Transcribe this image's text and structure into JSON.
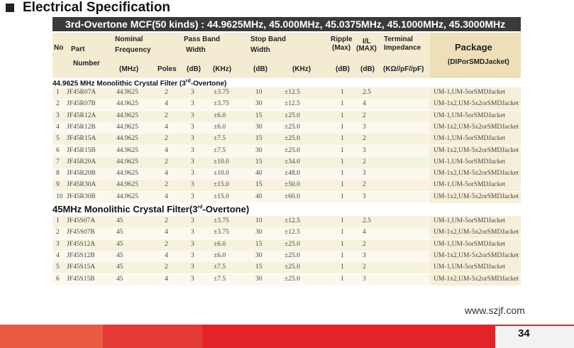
{
  "section_title": "Electrical Specification",
  "banner": "3rd-Overtone MCF(50 kinds) : 44.9625MHz, 45.000MHz, 45.0375MHz, 45.1000MHz, 45.3000MHz",
  "headers": {
    "no": "No",
    "part": "Part",
    "number": "Number",
    "nominal": "Nominal",
    "frequency": "Frequency",
    "mhz": "(MHz)",
    "poles": "Poles",
    "pass_band": "Pass  Band",
    "width1": "Width",
    "db1": "(dB)",
    "khz1": "(KHz)",
    "stop_band": "Stop    Band",
    "width2": "Width",
    "db2": "(dB)",
    "khz2": "(KHz)",
    "ripple": "Ripple",
    "max1": "(Max)",
    "db3": "(dB)",
    "il": "I/L",
    "max2": "(MAX)",
    "db4": "(dB)",
    "terminal": "Terminal",
    "impedance": "Impedance",
    "kohm_pf": "(KΩ//pF//pF)",
    "package": "Package",
    "package_sub": "(DIPorSMDJacket)"
  },
  "section1": {
    "title_pre": "44.9625 MHz Monolithic Crystal Filter (3",
    "title_sup": "rd",
    "title_post": "-Overtone)"
  },
  "rows1": [
    {
      "no": "1",
      "part": "JF45R07A",
      "freq": "44.9625",
      "poles": "2",
      "pdb": "3",
      "pkhz": "±3.75",
      "sdb": "10",
      "skhz": "±12.5",
      "ripple": "1",
      "il": "2.5",
      "pkg": "UM-1,UM-5orSMDJacket"
    },
    {
      "no": "2",
      "part": "JF45R07B",
      "freq": "44.9625",
      "poles": "4",
      "pdb": "3",
      "pkhz": "±3.75",
      "sdb": "30",
      "skhz": "±12.5",
      "ripple": "1",
      "il": "4",
      "pkg": "UM-1x2,UM-5x2orSMDJacket"
    },
    {
      "no": "3",
      "part": "JF45R12A",
      "freq": "44.9625",
      "poles": "2",
      "pdb": "3",
      "pkhz": "±6.0",
      "sdb": "15",
      "skhz": "±25.0",
      "ripple": "1",
      "il": "2",
      "pkg": "UM-1,UM-5orSMDJacket"
    },
    {
      "no": "4",
      "part": "JF45R12B",
      "freq": "44.9625",
      "poles": "4",
      "pdb": "3",
      "pkhz": "±6.0",
      "sdb": "30",
      "skhz": "±25.0",
      "ripple": "1",
      "il": "3",
      "pkg": "UM-1x2,UM-5x2orSMDJacket"
    },
    {
      "no": "5",
      "part": "JF45R15A",
      "freq": "44.9625",
      "poles": "2",
      "pdb": "3",
      "pkhz": "±7.5",
      "sdb": "15",
      "skhz": "±25.0",
      "ripple": "1",
      "il": "2",
      "pkg": "UM-1,UM-5orSMDJacket"
    },
    {
      "no": "6",
      "part": "JF45R15B",
      "freq": "44.9625",
      "poles": "4",
      "pdb": "3",
      "pkhz": "±7.5",
      "sdb": "30",
      "skhz": "±25.0",
      "ripple": "1",
      "il": "3",
      "pkg": "UM-1x2,UM-5x2orSMDJacket"
    },
    {
      "no": "7",
      "part": "JF45R20A",
      "freq": "44.9625",
      "poles": "2",
      "pdb": "3",
      "pkhz": "±10.0",
      "sdb": "15",
      "skhz": "±34.0",
      "ripple": "1",
      "il": "2",
      "pkg": "UM-1,UM-5orSMDJacket"
    },
    {
      "no": "8",
      "part": "JF45R20B",
      "freq": "44.9625",
      "poles": "4",
      "pdb": "3",
      "pkhz": "±10.0",
      "sdb": "40",
      "skhz": "±48.0",
      "ripple": "1",
      "il": "3",
      "pkg": "UM-1x2,UM-5x2orSMDJacket"
    },
    {
      "no": "9",
      "part": "JF45R30A",
      "freq": "44.9625",
      "poles": "2",
      "pdb": "3",
      "pkhz": "±15.0",
      "sdb": "15",
      "skhz": "±50.0",
      "ripple": "1",
      "il": "2",
      "pkg": "UM-1,UM-5orSMDJacket"
    },
    {
      "no": "10",
      "part": "JF45R30B",
      "freq": "44.9625",
      "poles": "4",
      "pdb": "3",
      "pkhz": "±15.0",
      "sdb": "40",
      "skhz": "±60.0",
      "ripple": "1",
      "il": "3",
      "pkg": "UM-1x2,UM-5x2orSMDJacket"
    }
  ],
  "section2": {
    "title_pre": "45MHz Monolithic Crystal Filter(3",
    "title_sup": "rd",
    "title_post": "-Overtone)"
  },
  "rows2": [
    {
      "no": "1",
      "part": "JF45S07A",
      "freq": "45",
      "poles": "2",
      "pdb": "3",
      "pkhz": "±3.75",
      "sdb": "10",
      "skhz": "±12.5",
      "ripple": "1",
      "il": "2.5",
      "pkg": "UM-1,UM-5orSMDJacket"
    },
    {
      "no": "2",
      "part": "JF45S07B",
      "freq": "45",
      "poles": "4",
      "pdb": "3",
      "pkhz": "±3.75",
      "sdb": "30",
      "skhz": "±12.5",
      "ripple": "1",
      "il": "4",
      "pkg": "UM-1x2,UM-5x2orSMDJacket"
    },
    {
      "no": "3",
      "part": "JF45S12A",
      "freq": "45",
      "poles": "2",
      "pdb": "3",
      "pkhz": "±6.0",
      "sdb": "15",
      "skhz": "±25.0",
      "ripple": "1",
      "il": "2",
      "pkg": "UM-1,UM-5orSMDJacket"
    },
    {
      "no": "4",
      "part": "JF45S12B",
      "freq": "45",
      "poles": "4",
      "pdb": "3",
      "pkhz": "±6.0",
      "sdb": "30",
      "skhz": "±25.0",
      "ripple": "1",
      "il": "3",
      "pkg": "UM-1x2,UM-5x2orSMDJacket"
    },
    {
      "no": "5",
      "part": "JF45S15A",
      "freq": "45",
      "poles": "2",
      "pdb": "3",
      "pkhz": "±7.5",
      "sdb": "15",
      "skhz": "±25.0",
      "ripple": "1",
      "il": "2",
      "pkg": "UM-1,UM-5orSMDJacket"
    },
    {
      "no": "6",
      "part": "JF45S15B",
      "freq": "45",
      "poles": "4",
      "pdb": "3",
      "pkhz": "±7.5",
      "sdb": "30",
      "skhz": "±25.0",
      "ripple": "1",
      "il": "3",
      "pkg": "UM-1x2,UM-5x2orSMDJacket"
    }
  ],
  "website": "www.szjf.com",
  "page_number": "34",
  "colors": {
    "footer_red": "#e2242a",
    "banner": "#3a3a3a",
    "header_bg": "#f3ecd3"
  }
}
